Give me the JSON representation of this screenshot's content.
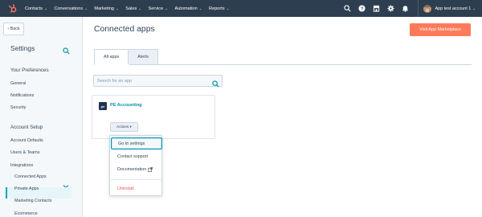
{
  "topnav": {
    "logo_icon": "hubspot-sprocket-icon",
    "items": [
      {
        "label": "Contacts"
      },
      {
        "label": "Conversations"
      },
      {
        "label": "Marketing"
      },
      {
        "label": "Sales"
      },
      {
        "label": "Service"
      },
      {
        "label": "Automation"
      },
      {
        "label": "Reports"
      }
    ],
    "chevron": "⌄",
    "right_icons": [
      "search-icon",
      "help-icon",
      "marketplace-icon",
      "settings-icon",
      "notifications-icon"
    ],
    "account_name": "App test account 1",
    "account_chevron": "⌄",
    "colors": {
      "bar": "#2d3e50",
      "logo": "#ff7a59"
    }
  },
  "sidebar": {
    "back_label": "‹ Back",
    "title": "Settings",
    "sections": [
      {
        "heading": "Your Preferences",
        "items": [
          "General",
          "Notifications",
          "Security"
        ]
      },
      {
        "heading": "Account Setup",
        "items": [
          "Account Defaults",
          "Users & Teams",
          "Integrations"
        ]
      }
    ],
    "integrations_subitems": [
      "Connected Apps",
      "Private Apps",
      "Marketing Contacts",
      "Ecommerce"
    ],
    "active_item": "Connected Apps",
    "colors": {
      "bg": "#f5f8fa",
      "active_bg": "#e5f5f8",
      "accent": "#00a4bd"
    }
  },
  "main": {
    "title": "Connected apps",
    "visit_button": "Visit App Marketplace",
    "tabs": [
      {
        "label": "All apps",
        "active": true
      },
      {
        "label": "Alerts",
        "active": false
      }
    ],
    "search": {
      "placeholder": "Search for an app",
      "value": ""
    },
    "app": {
      "logo_text": "pe",
      "name": "PE Accounting",
      "actions_label": "Actions ▾"
    },
    "dropdown": {
      "items": [
        "Go to settings",
        "Contact support",
        "Documentation"
      ],
      "danger_item": "Uninstall",
      "focused_item": "Go to settings"
    },
    "colors": {
      "primary_button": "#ff7a59",
      "link": "#0091ae",
      "danger": "#f2545b"
    }
  }
}
